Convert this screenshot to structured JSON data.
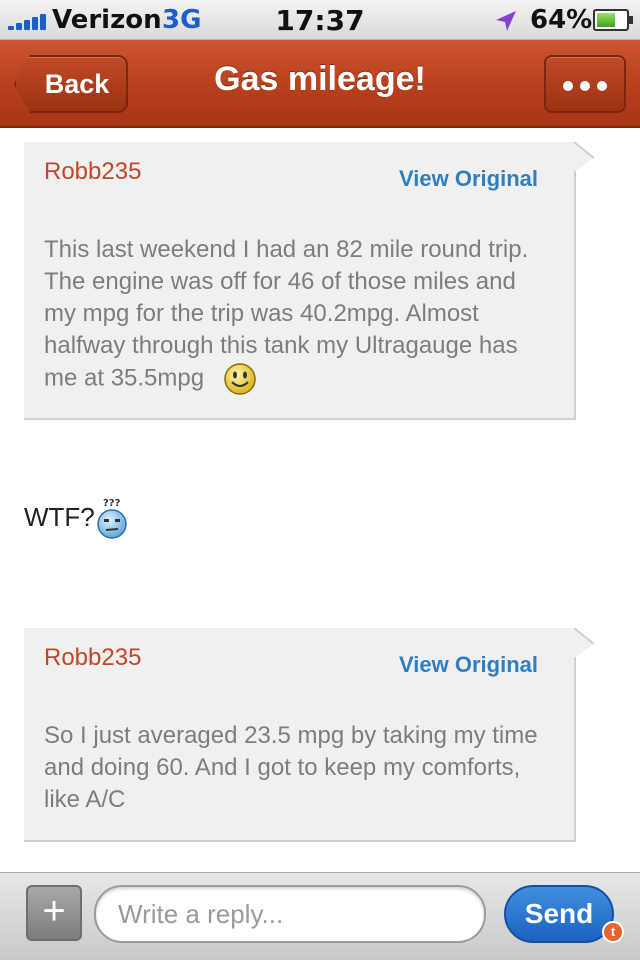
{
  "status_bar": {
    "carrier": "Verizon",
    "network": "3G",
    "time": "17:37",
    "battery_percent": "64%",
    "battery_level": 0.64,
    "signal_bars": 5,
    "icons": [
      "signal-icon",
      "location-arrow-icon",
      "battery-icon"
    ]
  },
  "navbar": {
    "back_label": "Back",
    "title": "Gas mileage!",
    "more_icon": "more-dots-icon"
  },
  "thread": {
    "quotes": [
      {
        "author": "Robb235",
        "view_original_label": "View Original",
        "text": "This last weekend I had an 82 mile round trip. The engine was off for 46 of those miles and my mpg for the trip was 40.2mpg. Almost halfway through this tank my Ultragauge has me at 35.5mpg",
        "emoticon": "smiley-icon"
      },
      {
        "author": "Robb235",
        "view_original_label": "View Original",
        "text": "So I just averaged 23.5 mpg by taking my time and doing 60. And I got to keep my comforts, like A/C"
      }
    ],
    "post": {
      "text": "WTF?",
      "emoticon": "confused-icon"
    }
  },
  "reply_bar": {
    "add_icon": "plus-icon",
    "input_placeholder": "Write a reply...",
    "input_value": "",
    "send_label": "Send",
    "badge_glyph": "t"
  },
  "colors": {
    "nav_red": "#b53e1c",
    "author_red": "#c1472a",
    "link_blue": "#2f7fc0",
    "send_blue": "#1c62c0",
    "quote_bg": "#f0f0f0"
  }
}
